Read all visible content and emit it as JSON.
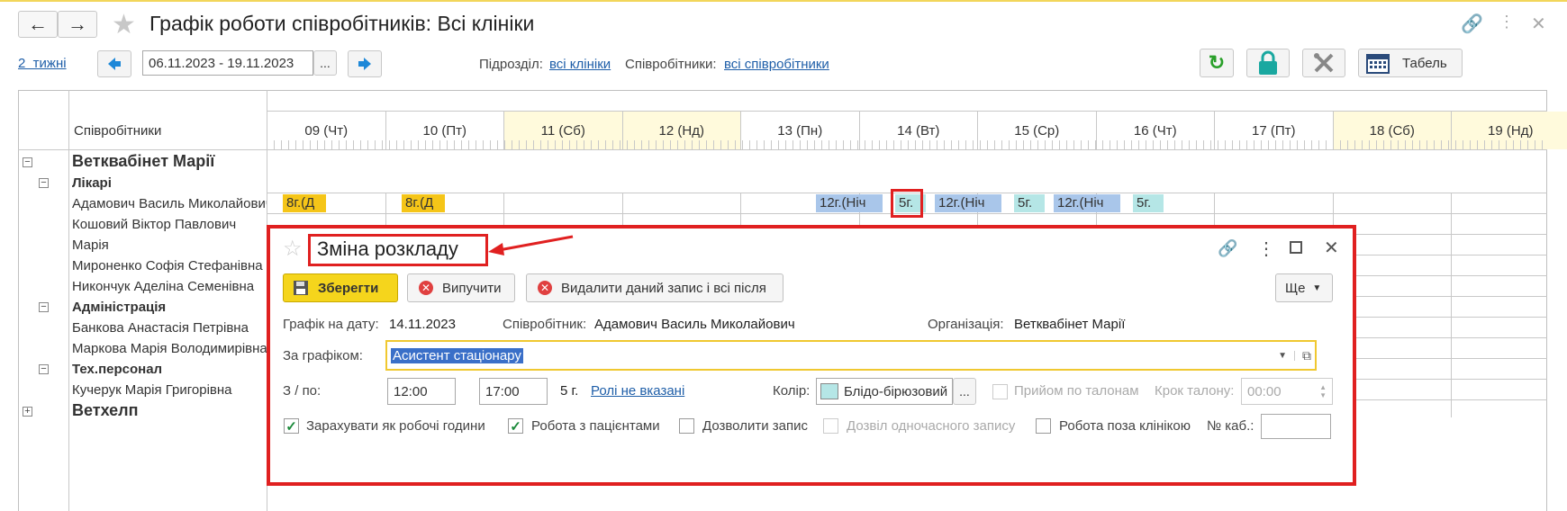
{
  "header": {
    "title": "Графік роботи співробітників: Всі клініки"
  },
  "toolbar": {
    "period_link": "2  тижні",
    "date_range": "06.11.2023 - 19.11.2023",
    "ellipsis": "...",
    "dept_label": "Підрозділ:",
    "dept_value": "всі клініки",
    "emp_label": "Співробітники:",
    "emp_value": "всі співробітники",
    "tabel": "Табель"
  },
  "grid": {
    "emp_header": "Співробітники",
    "days": [
      {
        "label": "09 (Чт)",
        "weekend": false
      },
      {
        "label": "10 (Пт)",
        "weekend": false
      },
      {
        "label": "11 (Сб)",
        "weekend": true
      },
      {
        "label": "12 (Нд)",
        "weekend": true
      },
      {
        "label": "13 (Пн)",
        "weekend": false
      },
      {
        "label": "14 (Вт)",
        "weekend": false
      },
      {
        "label": "15 (Ср)",
        "weekend": false
      },
      {
        "label": "16 (Чт)",
        "weekend": false
      },
      {
        "label": "17 (Пт)",
        "weekend": false
      },
      {
        "label": "18 (Сб)",
        "weekend": true
      },
      {
        "label": "19 (Нд)",
        "weekend": true
      }
    ],
    "org1": "Ветквабінет Марії",
    "group_doctors": "Лікарі",
    "doctors": [
      "Адамович Василь Миколайович",
      "Кошовий Віктор Павлович",
      "Марія",
      "Мироненко Софія Стефанівна",
      "Никончук Аделіна Семенівна"
    ],
    "group_admin": "Адміністрація",
    "admins": [
      "Банкова Анастасія Петрівна",
      "Маркова Марія Володимирівна"
    ],
    "group_tech": "Тех.персонал",
    "techs": [
      "Кучерук Марія Григорівна"
    ],
    "org2": "Ветхелп",
    "shifts": {
      "s1": "8г.(Д",
      "s2": "8г.(Д",
      "s3": "12г.(Ніч",
      "s4": "5г.",
      "s5": "12г.(Ніч",
      "s6": "5г.",
      "s7": "12г.(Ніч",
      "s8": "5г."
    }
  },
  "dialog": {
    "title": "Зміна розкладу",
    "save": "Зберегти",
    "exclude": "Випучити",
    "delete": "Видалити даний запис і всі після",
    "more": "Ще",
    "date_label": "Графік на дату:",
    "date_value": "14.11.2023",
    "employee_label": "Співробітник:",
    "employee_value": "Адамович Василь Миколайович",
    "org_label": "Організація:",
    "org_value": "Ветквабінет Марії",
    "schedule_label": "За графіком:",
    "schedule_value": "Асистент стаціонару",
    "from_to_label": "З / по:",
    "from": "12:00",
    "to": "17:00",
    "hours": "5 г.",
    "roles_link": "Ролі не вказані",
    "color_label": "Колір:",
    "color_value": "Блідо-бірюзовий",
    "color_swatch": "#b5e6e6",
    "tickets_label": "Прийом по талонам",
    "step_label": "Крок талону:",
    "step_value": "00:00",
    "cb_hours": "Зарахувати як робочі години",
    "cb_patients": "Робота з пацієнтами",
    "cb_allow": "Дозволити запис",
    "cb_simul": "Дозвіл одночасного запису",
    "cb_outside": "Робота поза клінікою",
    "cabinet_label": "№ каб.:"
  }
}
